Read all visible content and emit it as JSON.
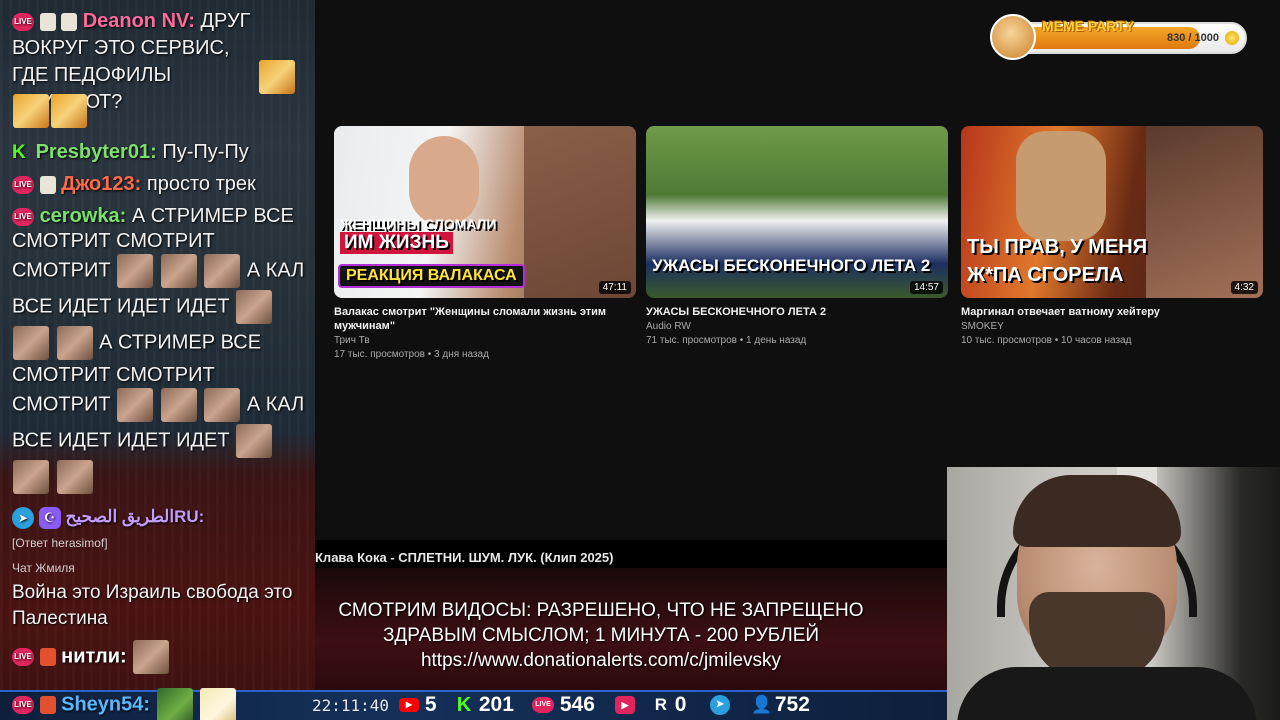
{
  "chat": {
    "messages": [
      {
        "user": "Deanon NV:",
        "user_color": "#ff6a9a",
        "text_line1": "ДРУГ",
        "text_rest": "ВОКРУГ ЭТО СЕРВИС, ГДЕ ПЕДОФИЛЫ ОБИТАЮТ?"
      },
      {
        "user": "Presbyter01:",
        "user_color": "#7de06b",
        "text": "Пу-Пу-Пу"
      },
      {
        "user": "Джо123:",
        "user_color": "#ff6b4a",
        "text": "просто трек"
      },
      {
        "user": "cerowka:",
        "user_color": "#7de06b",
        "text_a": "А СТРИМЕР ВСЕ",
        "text_b": "СМОТРИТ СМОТРИТ",
        "text_c": "СМОТРИТ",
        "text_d": "А КАЛ",
        "text_e": "ВСЕ ИДЕТ ИДЕТ ИДЕТ",
        "text_f": "А СТРИМЕР ВСЕ",
        "text_g": "СМОТРИТ СМОТРИТ",
        "text_h": "СМОТРИТ",
        "text_i": "А КАЛ",
        "text_j": "ВСЕ ИДЕТ ИДЕТ ИДЕТ"
      },
      {
        "user": "الطريق الصحيحRU:",
        "user_color": "#c49bff"
      },
      {
        "reply_note": "[Ответ herasimof]",
        "chat_label": "Чат Жмиля",
        "text": "Война это Израиль свобода это Палестина"
      },
      {
        "user": "нитли:",
        "user_color": "#ffffff"
      },
      {
        "user": "Sheyn54:",
        "user_color": "#5ab8ff"
      }
    ],
    "live_label": "LIVE"
  },
  "videos": [
    {
      "thumb_caption_top": "ЖЕНЩИНЫ СЛОМАЛИ",
      "thumb_caption_mid": "ИМ ЖИЗНЬ",
      "thumb_caption_bottom": "РЕАКЦИЯ ВАЛАКАСА",
      "duration": "47:11",
      "title": "Валакас смотрит \"Женщины сломали жизнь этим мужчинам\"",
      "channel": "Трич Тв",
      "meta": "17 тыс. просмотров • 3 дня назад"
    },
    {
      "thumb_caption": "УЖАСЫ БЕСКОНЕЧНОГО ЛЕТА 2",
      "duration": "14:57",
      "title": "УЖАСЫ БЕСКОНЕЧНОГО ЛЕТА 2",
      "channel": "Audio RW",
      "meta": "71 тыс. просмотров • 1 день назад"
    },
    {
      "thumb_caption_top": "ТЫ ПРАВ, У МЕНЯ",
      "thumb_caption_bottom": "Ж*ПА СГОРЕЛА",
      "duration": "4:32",
      "title": "Маргинал отвечает ватному хейтеру",
      "channel": "SMOKEY",
      "meta": "10 тыс. просмотров • 10 часов назад"
    }
  ],
  "now_playing": "Клава Кока - СПЛЕТНИ. ШУМ. ЛУК. (Клип 2025)",
  "donation": {
    "line1": "СМОТРИМ ВИДОСЫ: РАЗРЕШЕНО, ЧТО НЕ ЗАПРЕЩЕНО",
    "line2": "ЗДРАВЫМ СМЫСЛОМ; 1 МИНУТА - 200 РУБЛЕЙ",
    "line3": "https://www.donationalerts.com/c/jmilevsky"
  },
  "stats": {
    "clock": "22:11:40",
    "youtube": "5",
    "kick": "201",
    "live": "546",
    "rutube": "0",
    "viewers": "752"
  },
  "meme_party": {
    "title": "MEME PARTY",
    "score": "830 / 1000",
    "progress": 0.83
  },
  "colors": {
    "live_badge": "#e0245e",
    "kick_green": "#53fc18",
    "telegram_blue": "#2aa1de",
    "youtube_red": "#ff0000"
  },
  "icons": {
    "youtube": "▶",
    "kick": "K",
    "rutube": "R",
    "rutube_play": "▶",
    "telegram": "➤",
    "user": "👤",
    "moon": "☪"
  }
}
